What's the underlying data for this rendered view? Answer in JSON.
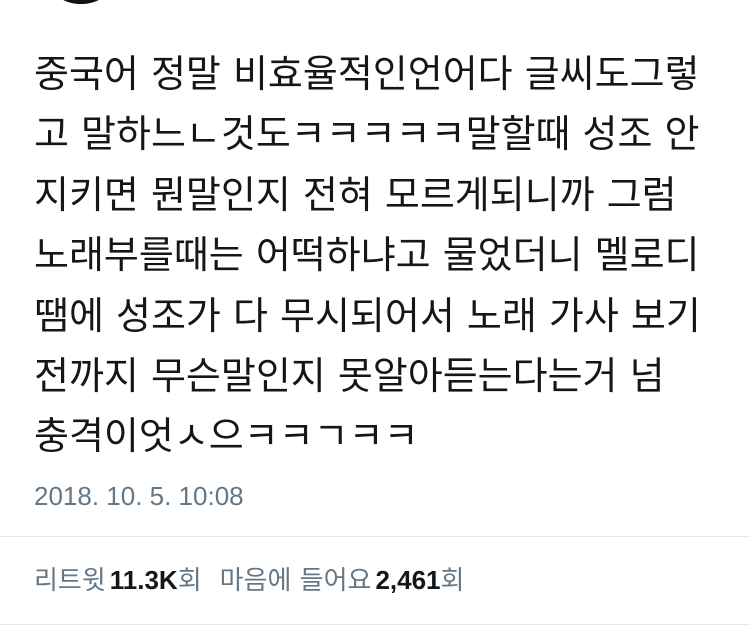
{
  "tweet": {
    "lines": [
      "중국어 정말 비효율적인언어다 글씨도그렇",
      "고 말하느ㄴ것도ㅋㅋㅋㅋㅋ말할때 성조 안",
      "지키면 뭔말인지 전혀 모르게되니까 그럼",
      "노래부를때는 어떡하냐고 물었더니 멜로디",
      "땜에 성조가 다 무시되어서 노래 가사 보기",
      "전까지 무슨말인지 못알아듣는다는거 넘",
      "충격이엇ㅅ으ㅋㅋㄱㅋㅋ"
    ],
    "timestamp": "2018. 10. 5. 10:08"
  },
  "stats": {
    "retweets": {
      "label": "리트윗",
      "count": "11.3K",
      "suffix": "회"
    },
    "likes": {
      "label": "마음에 들어요",
      "count": "2,461",
      "suffix": "회"
    }
  },
  "colors": {
    "text": "#14171a",
    "secondary": "#657786",
    "divider": "#e1e8ed"
  }
}
